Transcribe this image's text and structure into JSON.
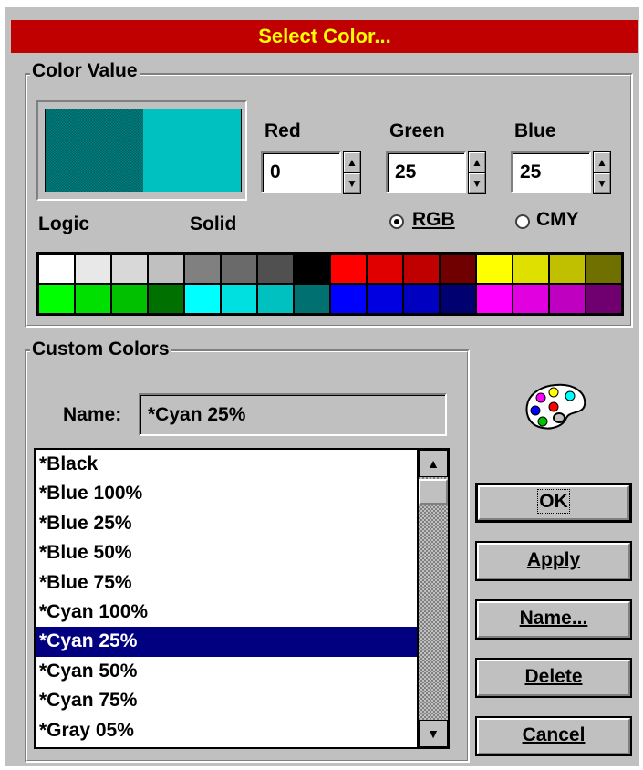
{
  "dialog": {
    "title": "Select Color..."
  },
  "color_value": {
    "group_label": "Color Value",
    "preview": {
      "logic_color": "#007070",
      "solid_color": "#00c0c0"
    },
    "logic_label": "Logic",
    "solid_label": "Solid",
    "red": {
      "label": "Red",
      "value": "0"
    },
    "green": {
      "label": "Green",
      "value": "25"
    },
    "blue": {
      "label": "Blue",
      "value": "25"
    },
    "mode": {
      "rgb_label": "RGB",
      "cmy_label": "CMY",
      "selected": "RGB"
    },
    "palette_row1": [
      "#ffffff",
      "#e8e8e8",
      "#d8d8d8",
      "#c0c0c0",
      "#808080",
      "#6a6a6a",
      "#505050",
      "#000000",
      "#ff0000",
      "#e00000",
      "#c00000",
      "#700000",
      "#ffff00",
      "#e0e000",
      "#c0c000",
      "#707000"
    ],
    "palette_row2": [
      "#00ff00",
      "#00e000",
      "#00c000",
      "#007000",
      "#00ffff",
      "#00e0e0",
      "#00c0c0",
      "#007070",
      "#0000ff",
      "#0000e0",
      "#0000c0",
      "#000070",
      "#ff00ff",
      "#e000e0",
      "#c000c0",
      "#700070"
    ]
  },
  "custom_colors": {
    "group_label": "Custom Colors",
    "name_label": "Name:",
    "name_value": "*Cyan 25%",
    "items": [
      "*Black",
      "*Blue 100%",
      "*Blue 25%",
      "*Blue 50%",
      "*Blue 75%",
      "*Cyan 100%",
      "*Cyan 25%",
      "*Cyan 50%",
      "*Cyan 75%",
      "*Gray 05%"
    ],
    "selected_item": "*Cyan 25%"
  },
  "buttons": {
    "ok": "OK",
    "apply": "Apply",
    "name": "Name...",
    "delete": "Delete",
    "cancel": "Cancel"
  },
  "icons": {
    "palette": "palette-icon",
    "scroll_up": "arrow-up-icon",
    "scroll_down": "arrow-down-icon"
  }
}
